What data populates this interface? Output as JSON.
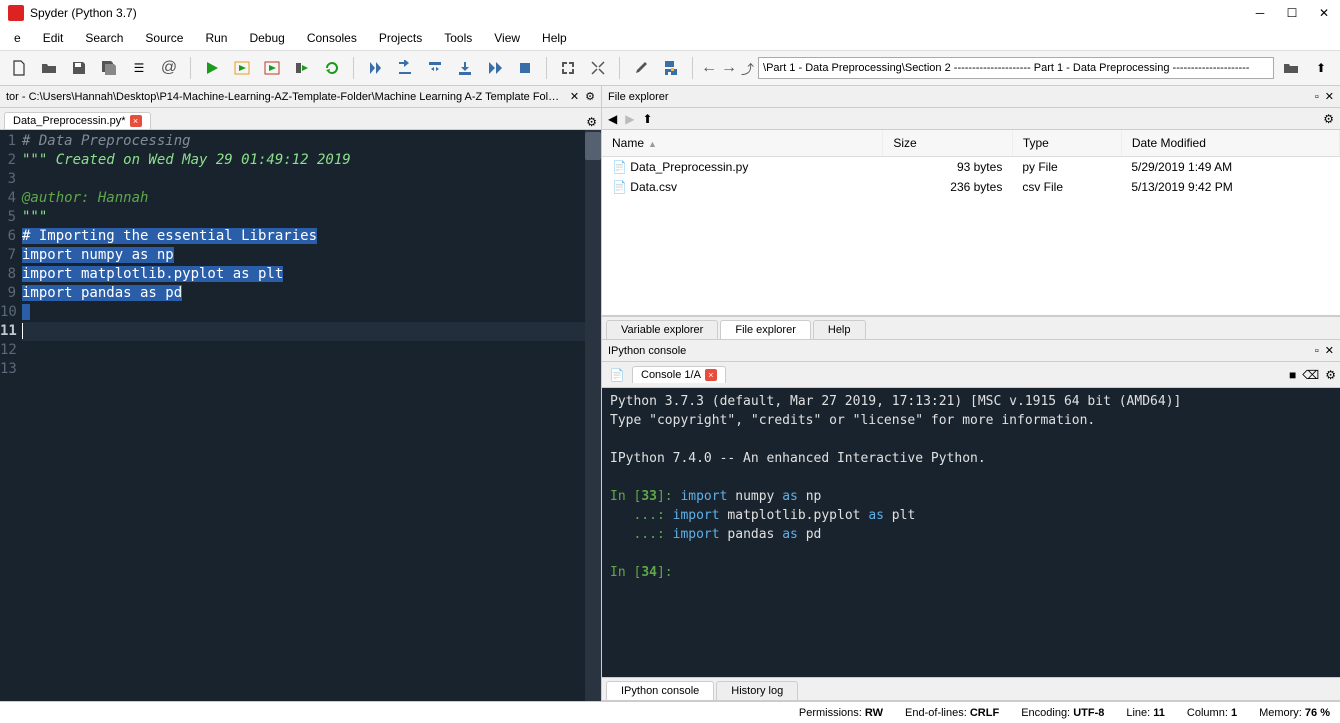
{
  "title": "Spyder (Python 3.7)",
  "menus": [
    "e",
    "Edit",
    "Search",
    "Source",
    "Run",
    "Debug",
    "Consoles",
    "Projects",
    "Tools",
    "View",
    "Help"
  ],
  "path_select": "\\Part 1 - Data Preprocessing\\Section 2 --------------------- Part 1 - Data Preprocessing ---------------------",
  "editor": {
    "header": "tor - C:\\Users\\Hannah\\Desktop\\P14-Machine-Learning-AZ-Template-Folder\\Machine Learning A-Z Template Folder\\...",
    "tab": "Data_Preprocessin.py*",
    "lines": [
      {
        "n": 1,
        "type": "comment",
        "text": "# Data Preprocessing"
      },
      {
        "n": 2,
        "type": "string",
        "text": "\"\"\" Created on Wed May 29 01:49:12 2019"
      },
      {
        "n": 3,
        "type": "blank",
        "text": ""
      },
      {
        "n": 4,
        "type": "decorator",
        "text": "@author: Hannah"
      },
      {
        "n": 5,
        "type": "string",
        "text": "\"\"\""
      },
      {
        "n": 6,
        "type": "selcomment",
        "text": "# Importing the essential Libraries"
      },
      {
        "n": 7,
        "type": "selimport",
        "kw": "import",
        "a": "numpy",
        "as": "as",
        "b": "np"
      },
      {
        "n": 8,
        "type": "selimport",
        "kw": "import",
        "a": "matplotlib.pyplot",
        "as": "as",
        "b": "plt"
      },
      {
        "n": 9,
        "type": "selimport",
        "kw": "import",
        "a": "pandas",
        "as": "as",
        "b": "pd"
      },
      {
        "n": 10,
        "type": "sel-empty",
        "text": " "
      },
      {
        "n": 11,
        "type": "current",
        "text": ""
      },
      {
        "n": 12,
        "type": "blank",
        "text": ""
      },
      {
        "n": 13,
        "type": "blank",
        "text": ""
      }
    ]
  },
  "file_explorer": {
    "title": "File explorer",
    "columns": [
      "Name",
      "Size",
      "Type",
      "Date Modified"
    ],
    "rows": [
      {
        "name": "Data_Preprocessin.py",
        "size": "93 bytes",
        "type": "py File",
        "date": "5/29/2019 1:49 AM"
      },
      {
        "name": "Data.csv",
        "size": "236 bytes",
        "type": "csv File",
        "date": "5/13/2019 9:42 PM"
      }
    ]
  },
  "mid_tabs": [
    "Variable explorer",
    "File explorer",
    "Help"
  ],
  "mid_active": 1,
  "ipython": {
    "title": "IPython console",
    "tab": "Console 1/A",
    "banner1": "Python 3.7.3 (default, Mar 27 2019, 17:13:21) [MSC v.1915 64 bit (AMD64)]",
    "banner2": "Type \"copyright\", \"credits\" or \"license\" for more information.",
    "banner3": "IPython 7.4.0 -- An enhanced Interactive Python.",
    "in33": "In [33]:",
    "cont": "   ...:",
    "imp1_kw": "import",
    "imp1_a": "numpy",
    "imp1_as": "as",
    "imp1_b": "np",
    "imp2_kw": "import",
    "imp2_a": "matplotlib.pyplot",
    "imp2_as": "as",
    "imp2_b": "plt",
    "imp3_kw": "import",
    "imp3_a": "pandas",
    "imp3_as": "as",
    "imp3_b": "pd",
    "in34": "In [34]:"
  },
  "bottom_tabs": [
    "IPython console",
    "History log"
  ],
  "status": {
    "perm_label": "Permissions:",
    "perm_val": "RW",
    "eol_label": "End-of-lines:",
    "eol_val": "CRLF",
    "enc_label": "Encoding:",
    "enc_val": "UTF-8",
    "line_label": "Line:",
    "line_val": "11",
    "col_label": "Column:",
    "col_val": "1",
    "mem_label": "Memory:",
    "mem_val": "76 %"
  }
}
